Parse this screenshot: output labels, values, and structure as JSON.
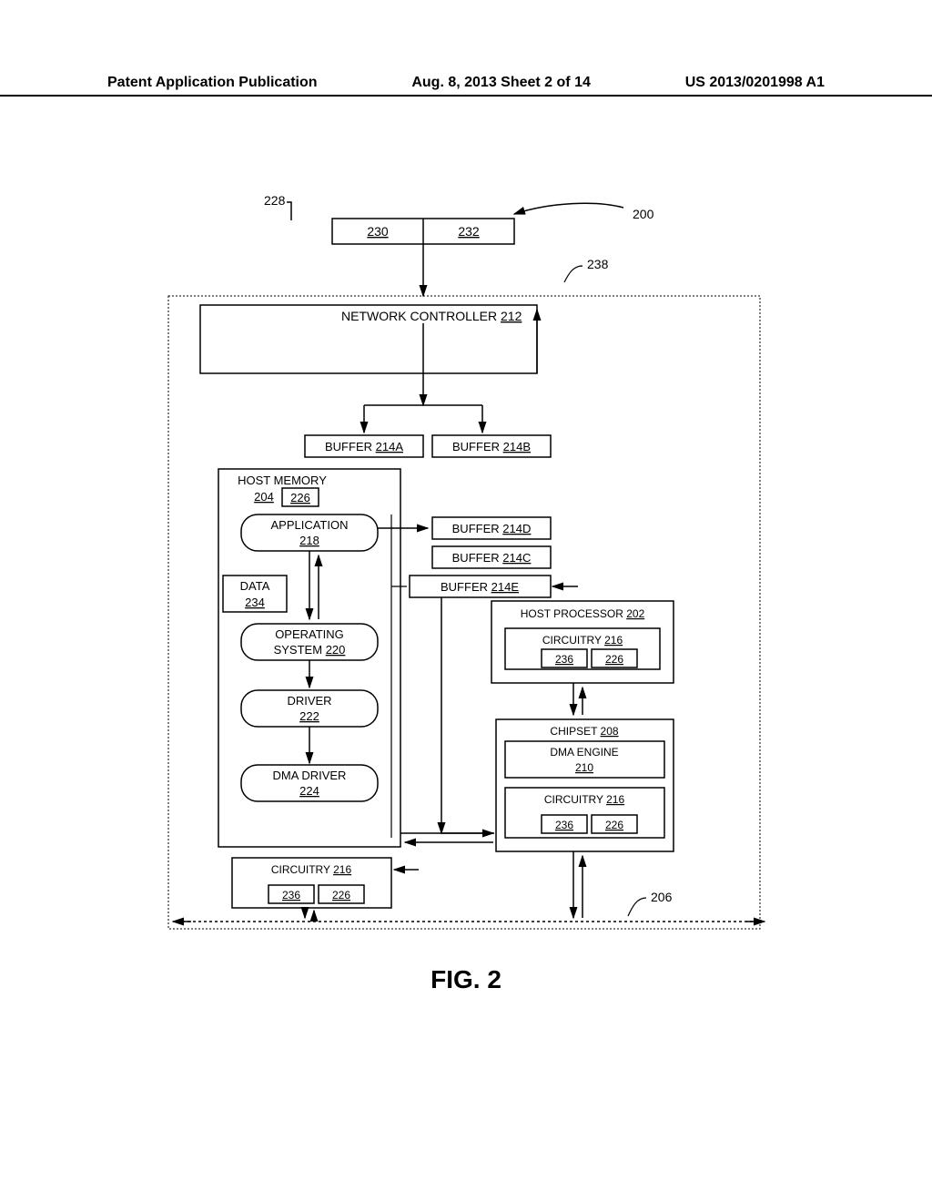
{
  "header": {
    "left": "Patent Application Publication",
    "center": "Aug. 8, 2013  Sheet 2 of 14",
    "right": "US 2013/0201998 A1"
  },
  "figure_label": "FIG. 2",
  "labels": {
    "l228": "228",
    "l200": "200",
    "l230": "230",
    "l232": "232",
    "l238": "238",
    "nc212": "NETWORK CONTROLLER",
    "n212": "212",
    "buf214a": "BUFFER",
    "n214a": "214A",
    "buf214b": "BUFFER",
    "n214b": "214B",
    "hostmem": "HOST MEMORY",
    "n204": "204",
    "n226a": "226",
    "buf214d": "BUFFER",
    "n214d": "214D",
    "app": "APPLICATION",
    "n218": "218",
    "buf214c": "BUFFER",
    "n214c": "214C",
    "buf214e": "BUFFER",
    "n214e": "214E",
    "data": "DATA",
    "n234": "234",
    "hostproc": "HOST PROCESSOR",
    "n202": "202",
    "os1": "OPERATING",
    "os2": "SYSTEM",
    "n220": "220",
    "circ216a": "CIRCUITRY",
    "n216a": "216",
    "n236a": "236",
    "n226b": "226",
    "driver": "DRIVER",
    "n222": "222",
    "chipset": "CHIPSET",
    "n208": "208",
    "dmaeng": "DMA ENGINE",
    "n210": "210",
    "dmadrv": "DMA DRIVER",
    "n224": "224",
    "circ216b": "CIRCUITRY",
    "n216b": "216",
    "n236b": "236",
    "n226c": "226",
    "circ216c": "CIRCUITRY",
    "n216c": "216",
    "n236c": "236",
    "n226d": "226",
    "l206": "206"
  }
}
